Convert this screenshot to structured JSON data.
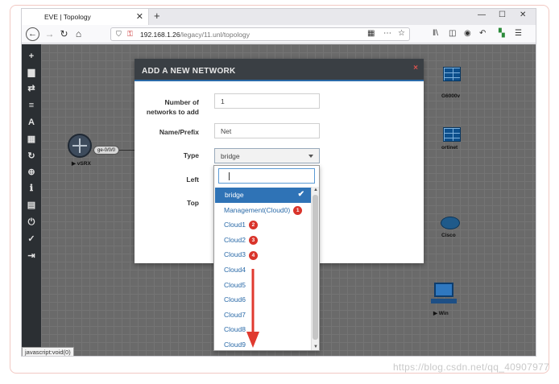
{
  "browser": {
    "tab_title": "EVE | Topology",
    "tab_close": "✕",
    "new_tab": "+",
    "url_host": "192.168.1.26",
    "url_path": "/legacy/11.unl/topology",
    "win_minimize": "—",
    "win_maximize": "☐",
    "win_close": "✕"
  },
  "sidebar": {
    "icons": [
      "add-icon",
      "node-icon",
      "network-swap-icon",
      "list-icon",
      "text-icon",
      "grid-icon",
      "refresh-icon",
      "zoom-icon",
      "info-icon",
      "notes-icon",
      "power-icon",
      "check-icon",
      "logout-icon"
    ]
  },
  "topology": {
    "node_vsrx": "▶ vSRX",
    "port_label": "ge-0/0/0",
    "node_fw1": "G6000v",
    "node_fortinet": "ortinet",
    "node_cisco": "Cisco",
    "node_win": "▶ Win"
  },
  "status_tip": "javascript:void(0)",
  "modal": {
    "title": "ADD A NEW NETWORK",
    "close": "×",
    "label_count_1": "Number of",
    "label_count_2": "networks to add",
    "count_value": "1",
    "label_name": "Name/Prefix",
    "name_value": "Net",
    "label_type": "Type",
    "type_value": "bridge",
    "label_left": "Left",
    "label_top": "Top"
  },
  "dropdown": {
    "items": [
      {
        "label": "bridge",
        "badge": ""
      },
      {
        "label": "Management(Cloud0)",
        "badge": "1"
      },
      {
        "label": "Cloud1",
        "badge": "2"
      },
      {
        "label": "Cloud2",
        "badge": "3"
      },
      {
        "label": "Cloud3",
        "badge": "4"
      },
      {
        "label": "Cloud4",
        "badge": ""
      },
      {
        "label": "Cloud5",
        "badge": ""
      },
      {
        "label": "Cloud6",
        "badge": ""
      },
      {
        "label": "Cloud7",
        "badge": ""
      },
      {
        "label": "Cloud8",
        "badge": ""
      },
      {
        "label": "Cloud9",
        "badge": ""
      }
    ],
    "selected_index": 0,
    "check": "✔"
  },
  "watermark": "https://blog.csdn.net/qq_40907977",
  "colors": {
    "accent": "#2f73b6",
    "badge": "#d9342b",
    "annotation_arrow": "#e03a2f"
  }
}
